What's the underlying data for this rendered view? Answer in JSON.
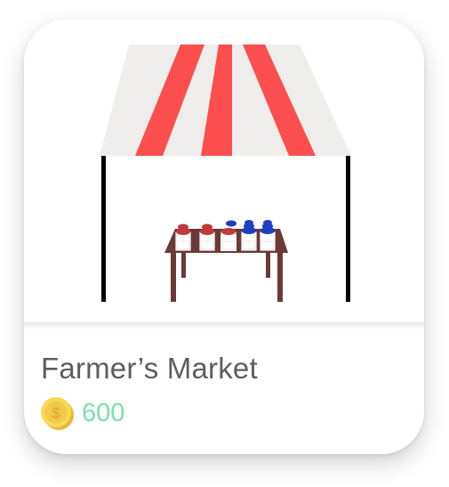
{
  "item": {
    "title": "Farmer’s Market",
    "price": "600",
    "currency_icon": "coin-icon",
    "image_icon": "market-stall-icon"
  },
  "colors": {
    "awning_red": "#fc4e4e",
    "awning_white": "#efeeec",
    "pole": "#000000",
    "table": "#6b3a37",
    "price_text": "#7fe0a8",
    "title_text": "#5e5e5e",
    "coin": "#f5d24a"
  }
}
